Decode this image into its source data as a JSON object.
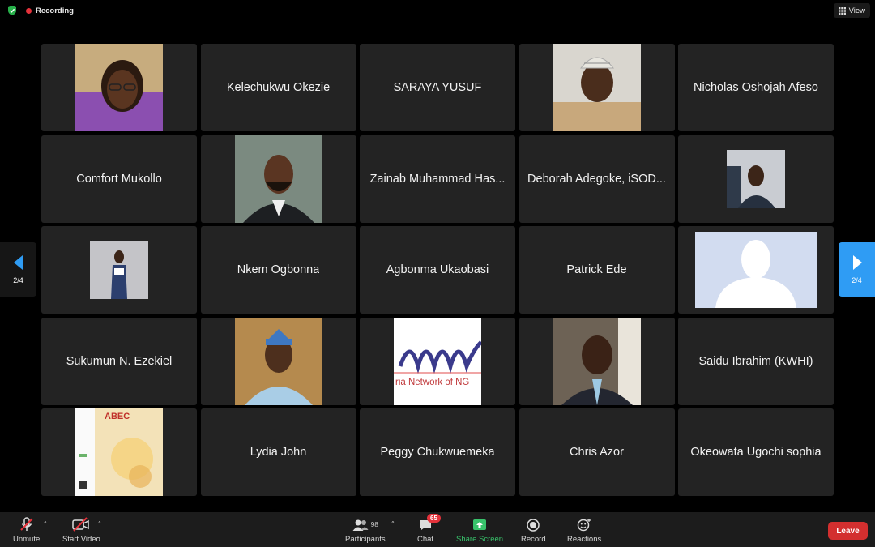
{
  "window": {
    "recording_label": "Recording",
    "view_label": "View"
  },
  "gallery": {
    "page_indicator_left": "2/4",
    "page_indicator_right": "2/4",
    "tiles": [
      {
        "name": "",
        "kind": "photo"
      },
      {
        "name": "Kelechukwu Okezie",
        "kind": "name"
      },
      {
        "name": "SARAYA YUSUF",
        "kind": "name"
      },
      {
        "name": "",
        "kind": "photo"
      },
      {
        "name": "Nicholas Oshojah Afeso",
        "kind": "name"
      },
      {
        "name": "Comfort Mukollo",
        "kind": "name"
      },
      {
        "name": "",
        "kind": "photo"
      },
      {
        "name": "Zainab Muhammad Has...",
        "kind": "name"
      },
      {
        "name": "Deborah Adegoke, iSOD...",
        "kind": "name"
      },
      {
        "name": "",
        "kind": "photo"
      },
      {
        "name": "",
        "kind": "photo"
      },
      {
        "name": "Nkem Ogbonna",
        "kind": "name"
      },
      {
        "name": "Agbonma Ukaobasi",
        "kind": "name"
      },
      {
        "name": "Patrick Ede",
        "kind": "name"
      },
      {
        "name": "",
        "kind": "photo"
      },
      {
        "name": "Sukumun N. Ezekiel",
        "kind": "name"
      },
      {
        "name": "",
        "kind": "photo"
      },
      {
        "name": "",
        "kind": "photo"
      },
      {
        "name": "",
        "kind": "photo"
      },
      {
        "name": "Saidu Ibrahim (KWHI)",
        "kind": "name"
      },
      {
        "name": "",
        "kind": "photo"
      },
      {
        "name": "Lydia John",
        "kind": "name"
      },
      {
        "name": "Peggy Chukwuemeka",
        "kind": "name"
      },
      {
        "name": "Chris Azor",
        "kind": "name"
      },
      {
        "name": "Okeowata Ugochi sophia",
        "kind": "name"
      }
    ],
    "logo_text_abec": "ABEC",
    "logo_text_network": "ria Network of NG"
  },
  "toolbar": {
    "unmute_label": "Unmute",
    "start_video_label": "Start Video",
    "participants_label": "Participants",
    "participants_count": "98",
    "chat_label": "Chat",
    "chat_badge": "65",
    "share_screen_label": "Share Screen",
    "record_label": "Record",
    "reactions_label": "Reactions",
    "leave_label": "Leave"
  },
  "colors": {
    "accent_blue": "#2f9cf4",
    "share_green": "#38c26b",
    "leave_red": "#d32f2f",
    "recording_red": "#e5323b",
    "tile_bg": "#232323"
  }
}
